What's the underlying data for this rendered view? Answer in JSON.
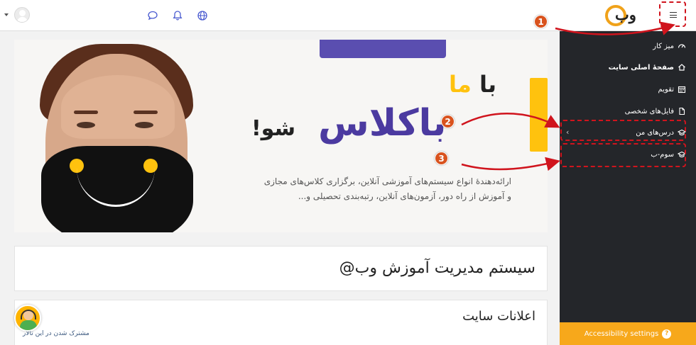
{
  "header": {
    "logo_text": "وب",
    "logo_at": "@",
    "icons": [
      "user-avatar",
      "chat-bubble-icon",
      "bell-icon",
      "globe-icon"
    ],
    "menu_icon": "hamburger-icon"
  },
  "drawer": {
    "items": [
      {
        "label": "میز کار",
        "icon": "gauge-icon",
        "bold": false
      },
      {
        "label": "صفحهٔ اصلی سایت",
        "icon": "home-icon",
        "bold": true
      },
      {
        "label": "تقویم",
        "icon": "calendar-icon",
        "bold": false
      },
      {
        "label": "فایل‌های شخصی",
        "icon": "file-icon",
        "bold": false
      },
      {
        "label": "درس‌های من",
        "icon": "graduation-cap-icon",
        "bold": false
      },
      {
        "label": "سوم-ب",
        "icon": "graduation-cap-icon",
        "bold": false
      }
    ],
    "accessibility_label": "Accessibility settings"
  },
  "annotations": {
    "badges": [
      "1",
      "2",
      "3"
    ],
    "color": "#d0141d"
  },
  "banner": {
    "line1_prefix": "با ",
    "line1_highlight": "ما",
    "line2": "باکلاس",
    "line3": "شو!",
    "description_line1": "ارائه‌دهندۀ انواع سیستم‌های آموزشی آنلاین، برگزاری کلاس‌های مجازی",
    "description_line2": "و آموزش از راه دور، آزمون‌های آنلاین، رتبه‌بندی تحصیلی و...",
    "colors": {
      "purple": "#4b3aa0",
      "yellow": "#ffc20e"
    }
  },
  "main": {
    "site_title": "سیستم مدیریت آموزش وب@",
    "announcements_title": "اعلانات سایت",
    "subscribe_link": "مشترک شدن در این تالار"
  },
  "colors": {
    "drawer_bg": "#24262a",
    "accessibility_bg": "#f7a81b"
  }
}
